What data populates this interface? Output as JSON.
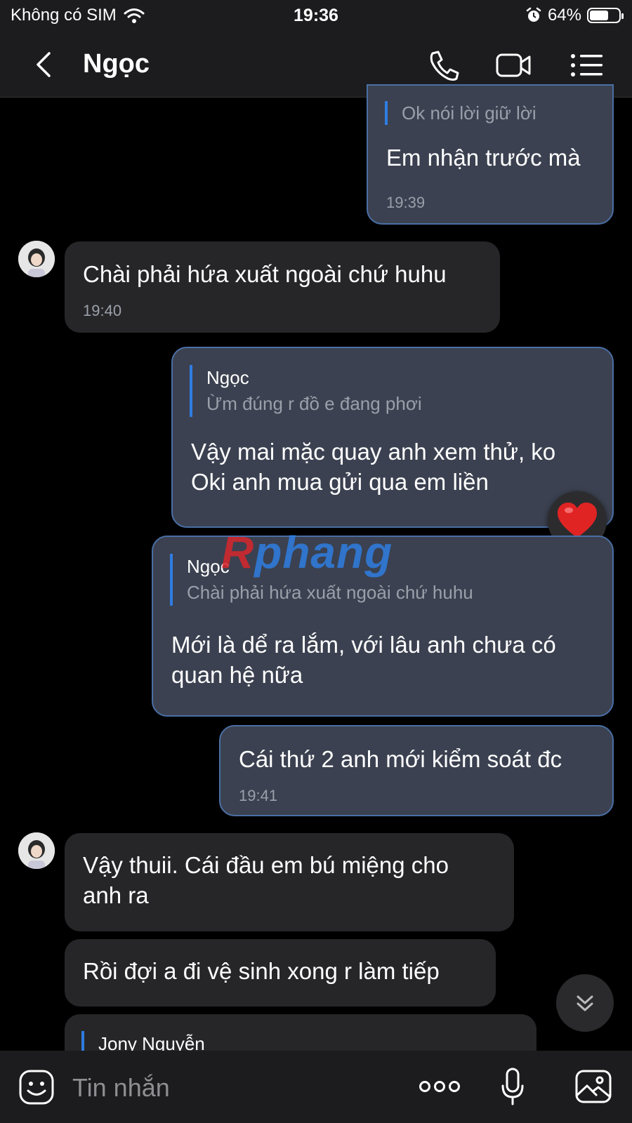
{
  "status_bar": {
    "carrier": "Không có SIM",
    "time": "19:36",
    "battery_percent": "64%",
    "battery_level": 0.64,
    "icons": [
      "wifi-icon",
      "alarm-icon",
      "battery-icon"
    ]
  },
  "header": {
    "title": "Ngọc",
    "icons": [
      "back-chevron-icon",
      "phone-icon",
      "video-camera-icon",
      "menu-list-icon"
    ]
  },
  "messages": [
    {
      "direction": "out",
      "quote_text": "Ok nói lời giữ lời",
      "text": "Em nhận trước mà",
      "time": "19:39"
    },
    {
      "direction": "in",
      "text": "Chài phải hứa xuất ngoài chứ huhu",
      "time": "19:40"
    },
    {
      "direction": "out",
      "quote_name": "Ngọc",
      "quote_text": "Ừm đúng r đồ e đang phơi",
      "text": "Vậy mai mặc quay anh xem thử, ko Oki anh mua gửi qua em liền",
      "reaction": "heart"
    },
    {
      "direction": "out",
      "quote_name": "Ngọc",
      "quote_text": "Chài phải hứa xuất ngoài chứ huhu",
      "text": "Mới là dể ra lắm, với lâu anh chưa có quan hệ nữa"
    },
    {
      "direction": "out",
      "text": "Cái thứ 2 anh mới kiểm soát đc",
      "time": "19:41"
    },
    {
      "direction": "in",
      "text": "Vậy thuii. Cái đầu em bú miệng cho anh ra"
    },
    {
      "direction": "in",
      "text": "Rồi đợi a đi vệ sinh xong r làm tiếp"
    },
    {
      "direction": "in",
      "quote_name": "Jony Nguyễn"
    }
  ],
  "watermark": {
    "first": "R",
    "rest": "phang"
  },
  "input_bar": {
    "placeholder": "Tin nhắn",
    "icons": [
      "emoji-icon",
      "more-icon",
      "microphone-icon",
      "image-icon"
    ]
  },
  "colors": {
    "background": "#000000",
    "bar": "#1c1c1e",
    "outgoing_bubble": "#3b4150",
    "incoming_bubble": "#262628",
    "accent": "#2f7de1"
  }
}
